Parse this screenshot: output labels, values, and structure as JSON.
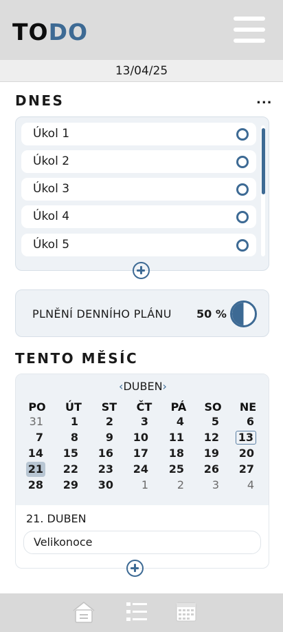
{
  "header": {
    "logo_part1": "TO",
    "logo_part2": "DO",
    "menu_icon": "hamburger-menu-icon"
  },
  "date_bar": {
    "date": "13/04/25"
  },
  "today": {
    "title": "DNES",
    "more_label": "...",
    "tasks": [
      {
        "label": "Úkol 1",
        "done": false
      },
      {
        "label": "Úkol 2",
        "done": false
      },
      {
        "label": "Úkol 3",
        "done": false
      },
      {
        "label": "Úkol 4",
        "done": false
      },
      {
        "label": "Úkol 5",
        "done": false
      }
    ],
    "add_icon": "plus-circle-icon"
  },
  "progress": {
    "label": "PLNĚNÍ DENNÍHO PLÁNU",
    "value_text": "50 %",
    "fraction": 0.5
  },
  "month": {
    "title": "TENTO MĚSÍC",
    "prev_arrow": "‹",
    "name": "DUBEN",
    "next_arrow": "›",
    "weekdays": [
      "PO",
      "ÚT",
      "ST",
      "ČT",
      "PÁ",
      "SO",
      "NE"
    ],
    "weeks": [
      [
        {
          "d": "31",
          "cur": false
        },
        {
          "d": "1",
          "cur": true
        },
        {
          "d": "2",
          "cur": true
        },
        {
          "d": "3",
          "cur": true
        },
        {
          "d": "4",
          "cur": true
        },
        {
          "d": "5",
          "cur": true
        },
        {
          "d": "6",
          "cur": true
        }
      ],
      [
        {
          "d": "7",
          "cur": true
        },
        {
          "d": "8",
          "cur": true
        },
        {
          "d": "9",
          "cur": true
        },
        {
          "d": "10",
          "cur": true
        },
        {
          "d": "11",
          "cur": true
        },
        {
          "d": "12",
          "cur": true
        },
        {
          "d": "13",
          "cur": true,
          "today": true
        }
      ],
      [
        {
          "d": "14",
          "cur": true
        },
        {
          "d": "15",
          "cur": true
        },
        {
          "d": "16",
          "cur": true
        },
        {
          "d": "17",
          "cur": true
        },
        {
          "d": "18",
          "cur": true
        },
        {
          "d": "19",
          "cur": true
        },
        {
          "d": "20",
          "cur": true
        }
      ],
      [
        {
          "d": "21",
          "cur": true,
          "selected": true
        },
        {
          "d": "22",
          "cur": true
        },
        {
          "d": "23",
          "cur": true
        },
        {
          "d": "24",
          "cur": true
        },
        {
          "d": "25",
          "cur": true
        },
        {
          "d": "26",
          "cur": true
        },
        {
          "d": "27",
          "cur": true
        }
      ],
      [
        {
          "d": "28",
          "cur": true
        },
        {
          "d": "29",
          "cur": true
        },
        {
          "d": "30",
          "cur": true
        },
        {
          "d": "1",
          "cur": false
        },
        {
          "d": "2",
          "cur": false
        },
        {
          "d": "3",
          "cur": false
        },
        {
          "d": "4",
          "cur": false
        }
      ]
    ],
    "selected_date_label": "21. DUBEN",
    "events": [
      {
        "label": "Velikonoce"
      }
    ],
    "add_icon": "plus-circle-icon"
  },
  "bottom_nav": [
    {
      "icon": "home-icon"
    },
    {
      "icon": "list-icon"
    },
    {
      "icon": "calendar-icon"
    }
  ],
  "colors": {
    "accent": "#3d6a94",
    "header_bg": "#dcdcdc",
    "panel_bg": "#eef2f6",
    "nav_bg": "#d9d9d9"
  }
}
